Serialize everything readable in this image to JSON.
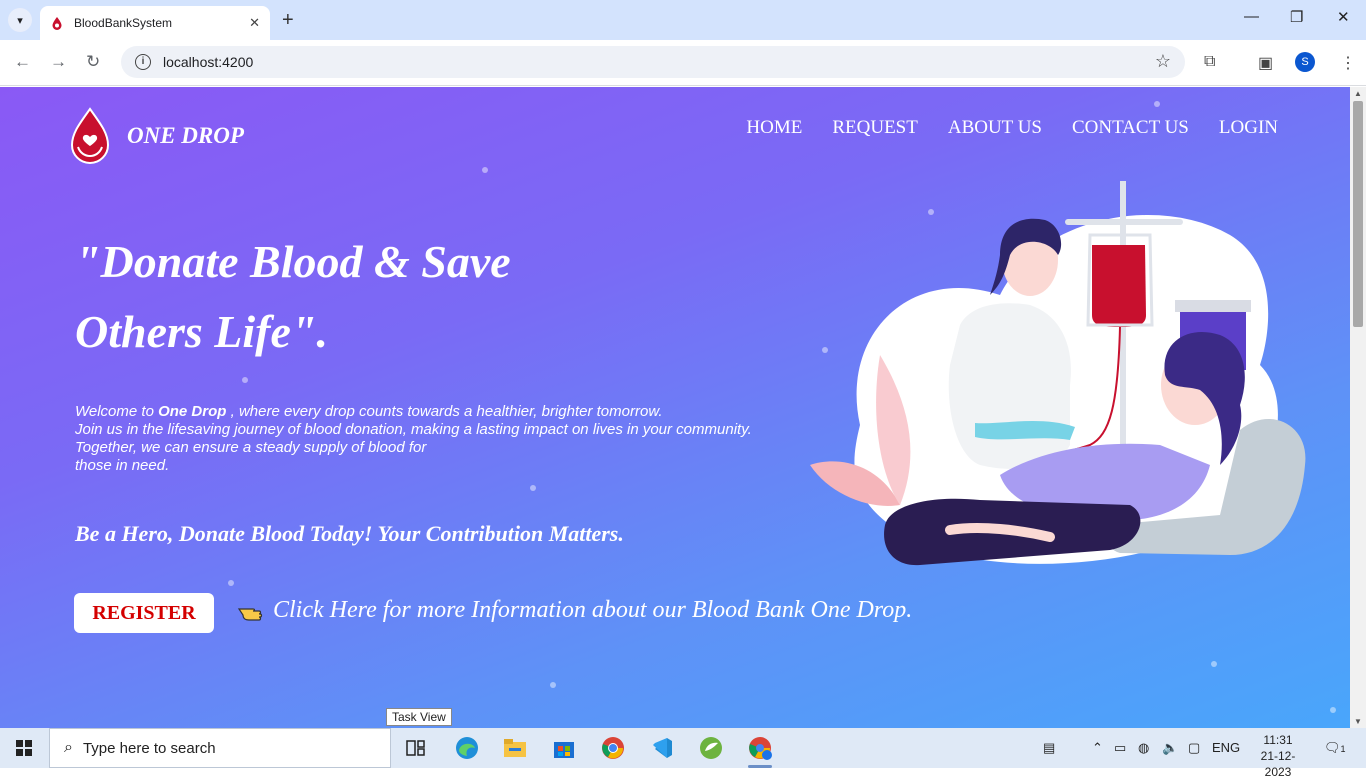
{
  "browser": {
    "tab_title": "BloodBankSystem",
    "url": "localhost:4200",
    "profile_initial": "S"
  },
  "header": {
    "brand": "ONE DROP",
    "nav": [
      "HOME",
      "REQUEST",
      "ABOUT US",
      "CONTACT US",
      "LOGIN"
    ]
  },
  "hero": {
    "headline_line1": "\"Donate Blood & Save",
    "headline_line2": "Others Life\".",
    "welcome_prefix": "Welcome to ",
    "welcome_brand": "One Drop",
    "welcome_suffix": " , where every drop counts towards a healthier, brighter tomorrow.",
    "welcome_line2": "Join us in the lifesaving journey of blood donation, making a lasting impact on lives in your community.",
    "welcome_line3": "Together, we can ensure a steady supply of blood for",
    "welcome_line4": "those in need.",
    "tagline": "Be a Hero, Donate Blood Today! Your Contribution Matters.",
    "register_label": "REGISTER",
    "info_link": "Click Here for more Information about our Blood Bank One Drop."
  },
  "tooltip": "Task View",
  "taskbar": {
    "search_placeholder": "Type here to search",
    "lang": "ENG",
    "time": "11:31",
    "date": "21-12-2023",
    "notification_count": "1"
  },
  "colors": {
    "page_gradient_start": "#8a59f5",
    "page_gradient_end": "#49a6fb",
    "register_text": "#d40000"
  }
}
